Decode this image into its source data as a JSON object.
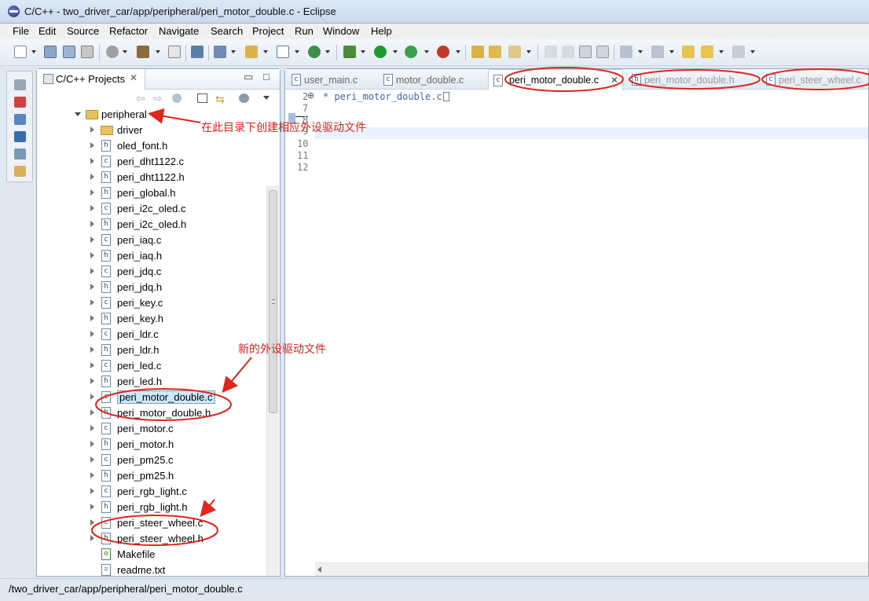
{
  "window": {
    "title": "C/C++ - two_driver_car/app/peripheral/peri_motor_double.c - Eclipse"
  },
  "menu": [
    "File",
    "Edit",
    "Source",
    "Refactor",
    "Navigate",
    "Search",
    "Project",
    "Run",
    "Window",
    "Help"
  ],
  "explorer": {
    "tab_label": "C/C++ Projects",
    "root": "peripheral",
    "items": [
      {
        "name": "driver",
        "kind": "folder"
      },
      {
        "name": "oled_font.h",
        "kind": "h"
      },
      {
        "name": "peri_dht1122.c",
        "kind": "c"
      },
      {
        "name": "peri_dht1122.h",
        "kind": "h"
      },
      {
        "name": "peri_global.h",
        "kind": "h"
      },
      {
        "name": "peri_i2c_oled.c",
        "kind": "c"
      },
      {
        "name": "peri_i2c_oled.h",
        "kind": "h"
      },
      {
        "name": "peri_iaq.c",
        "kind": "c"
      },
      {
        "name": "peri_iaq.h",
        "kind": "h"
      },
      {
        "name": "peri_jdq.c",
        "kind": "c"
      },
      {
        "name": "peri_jdq.h",
        "kind": "h"
      },
      {
        "name": "peri_key.c",
        "kind": "c"
      },
      {
        "name": "peri_key.h",
        "kind": "h"
      },
      {
        "name": "peri_ldr.c",
        "kind": "c"
      },
      {
        "name": "peri_ldr.h",
        "kind": "h"
      },
      {
        "name": "peri_led.c",
        "kind": "c"
      },
      {
        "name": "peri_led.h",
        "kind": "h"
      },
      {
        "name": "peri_motor_double.c",
        "kind": "c"
      },
      {
        "name": "peri_motor_double.h",
        "kind": "h"
      },
      {
        "name": "peri_motor.c",
        "kind": "c"
      },
      {
        "name": "peri_motor.h",
        "kind": "h"
      },
      {
        "name": "peri_pm25.c",
        "kind": "c"
      },
      {
        "name": "peri_pm25.h",
        "kind": "h"
      },
      {
        "name": "peri_rgb_light.c",
        "kind": "c"
      },
      {
        "name": "peri_rgb_light.h",
        "kind": "h"
      },
      {
        "name": "peri_steer_wheel.c",
        "kind": "c"
      },
      {
        "name": "peri_steer_wheel.h",
        "kind": "h"
      },
      {
        "name": "Makefile",
        "kind": "make"
      },
      {
        "name": "readme.txt",
        "kind": "txt"
      }
    ]
  },
  "editor": {
    "tabs": [
      {
        "label": "user_main.c",
        "active": false
      },
      {
        "label": "motor_double.c",
        "active": false
      },
      {
        "label": "peri_motor_double.c",
        "active": true
      },
      {
        "label": "peri_motor_double.h",
        "active": false
      },
      {
        "label": "peri_steer_wheel.c",
        "active": false
      }
    ],
    "line_numbers": [
      "2",
      "7",
      "8",
      "9",
      "10",
      "11",
      "12"
    ],
    "code_line": "* peri_motor_double.c"
  },
  "annotations": {
    "create_here": "在此目录下创建相应外设驱动文件",
    "new_driver": "新的外设驱动文件"
  },
  "status": {
    "path": "/two_driver_car/app/peripheral/peri_motor_double.c"
  },
  "colors": {
    "annotation": "#e0241e",
    "selection": "#cce8ff"
  }
}
